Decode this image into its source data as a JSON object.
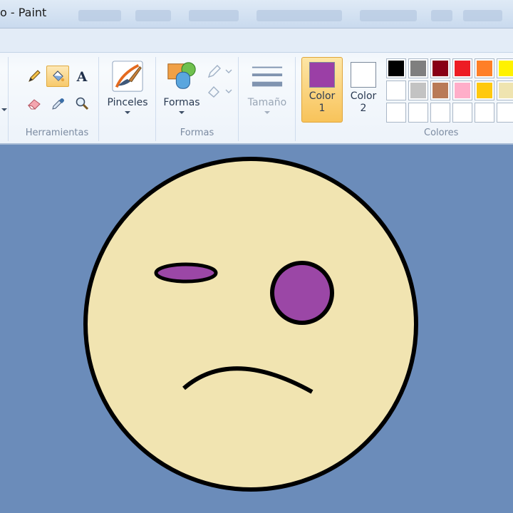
{
  "window": {
    "title": "o - Paint"
  },
  "ribbon": {
    "groups": {
      "herramientas": {
        "label": "Herramientas"
      },
      "formas": {
        "label": "Formas"
      },
      "colores": {
        "label": "Colores"
      }
    },
    "tools": [
      {
        "name": "pencil-icon"
      },
      {
        "name": "fill-bucket-icon",
        "active": true
      },
      {
        "name": "text-icon"
      },
      {
        "name": "eraser-icon"
      },
      {
        "name": "color-picker-icon"
      },
      {
        "name": "magnifier-icon"
      }
    ],
    "pinceles": {
      "label": "Pinceles"
    },
    "formas": {
      "label": "Formas"
    },
    "tamano": {
      "label": "Tamaño"
    },
    "color1": {
      "label_line1": "Color",
      "label_line2": "1",
      "color": "#9b3fa6"
    },
    "color2": {
      "label_line1": "Color",
      "label_line2": "2",
      "color": "#ffffff"
    },
    "palette_row1": [
      "#000000",
      "#7f7f7f",
      "#880015",
      "#ed1c24",
      "#ff7f27",
      "#fff200"
    ],
    "palette_row2": [
      "#ffffff",
      "#c3c3c3",
      "#b97a57",
      "#ffaec9",
      "#ffc90e",
      "#efe4b0"
    ]
  },
  "canvas": {
    "background": "#6b8cba",
    "face_fill": "#f1e4b1",
    "eye_fill": "#9b47a6",
    "outline": "#000000"
  }
}
